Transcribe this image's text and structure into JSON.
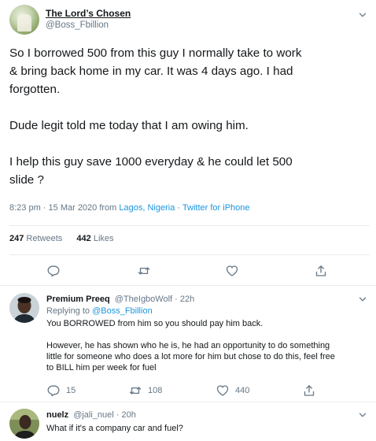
{
  "main_tweet": {
    "display_name": "The Lord’s Chosen",
    "handle": "@Boss_Fbillion",
    "text_lines": [
      "So I borrowed 500 from this guy I normally take to work",
      "& bring back home in my car. It was 4 days ago. I had",
      "forgotten.",
      "",
      "Dude legit told me today that I am owing him.",
      "",
      "I help this guy save 1000 everyday & he could let 500",
      "slide ?"
    ],
    "time": "8:23 pm · 15 Mar 2020 from ",
    "location": "Lagos, Nigeria",
    "separator": " · ",
    "source": "Twitter for iPhone",
    "retweets_count": "247",
    "retweets_label": "Retweets",
    "likes_count": "442",
    "likes_label": "Likes"
  },
  "replies": [
    {
      "display_name": "Premium Preeq",
      "handle": "@TheIgboWolf · 22h",
      "replying_prefix": "Replying to ",
      "replying_to": "@Boss_Fbillion",
      "text_lines": [
        "You BORROWED from him so you should pay him back.",
        "",
        "However, he has shown who he is, he had an opportunity to do something",
        "little for someone who does a lot more for him but chose to do this, feel free",
        "to BILL him per week for fuel"
      ],
      "reply_count": "15",
      "retweet_count": "108",
      "like_count": "440"
    },
    {
      "display_name": "nuelz",
      "handle": "@jali_nuel · 20h",
      "text_lines": [
        "What if it's a company car and fuel?"
      ]
    }
  ],
  "icons": {
    "reply": "reply-icon",
    "retweet": "retweet-icon",
    "like": "heart-icon",
    "share": "share-icon",
    "menu": "chevron-down-icon"
  },
  "colors": {
    "link": "#1b95e0",
    "secondary_text": "#657786",
    "primary_text": "#14171a",
    "divider": "#e6ecf0"
  }
}
